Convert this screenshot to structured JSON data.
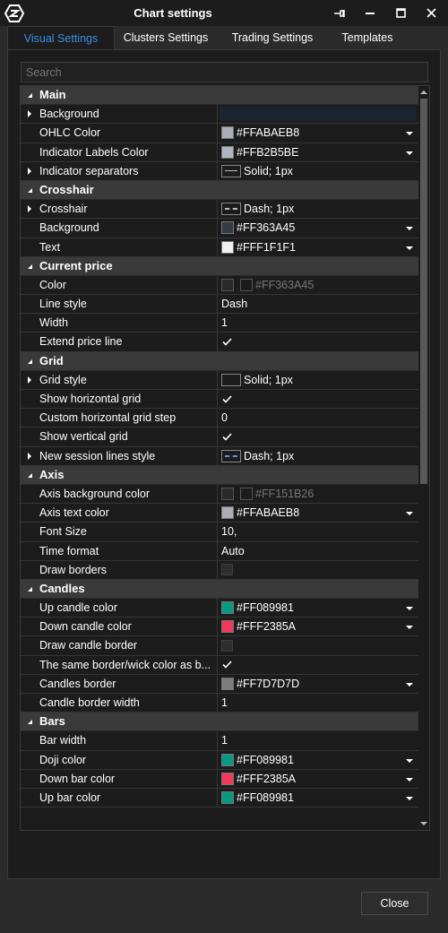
{
  "window": {
    "title": "Chart settings"
  },
  "tabs": [
    {
      "label": "Visual Settings"
    },
    {
      "label": "Clusters Settings"
    },
    {
      "label": "Trading Settings"
    },
    {
      "label": "Templates"
    }
  ],
  "search": {
    "placeholder": "Search"
  },
  "rows": [
    {
      "type": "section",
      "label": "Main"
    },
    {
      "type": "prop",
      "label": "Background",
      "expander": true,
      "value_kind": "colorbar",
      "color": "#1C2331"
    },
    {
      "type": "prop",
      "label": "OHLC Color",
      "value_kind": "color",
      "color": "#ABAEB8",
      "value": "#FFABAEB8",
      "dropdown": true
    },
    {
      "type": "prop",
      "label": "Indicator Labels Color",
      "value_kind": "color",
      "color": "#B2B5BE",
      "value": "#FFB2B5BE",
      "dropdown": true
    },
    {
      "type": "prop",
      "label": "Indicator separators",
      "expander": true,
      "value_kind": "line",
      "line": "solid",
      "value": "Solid; 1px"
    },
    {
      "type": "section",
      "label": "Crosshair"
    },
    {
      "type": "prop",
      "label": "Crosshair",
      "expander": true,
      "value_kind": "line",
      "line": "dash",
      "value": "Dash; 1px"
    },
    {
      "type": "prop",
      "label": "Background",
      "value_kind": "color",
      "color": "#363A45",
      "value": "#FF363A45",
      "dropdown": true
    },
    {
      "type": "prop",
      "label": "Text",
      "value_kind": "color",
      "color": "#F1F1F1",
      "value": "#FFF1F1F1",
      "dropdown": true
    },
    {
      "type": "section",
      "label": "Current price"
    },
    {
      "type": "prop",
      "label": "Color",
      "value_kind": "color-faded",
      "color": "#363A45",
      "value": "#FF363A45"
    },
    {
      "type": "prop",
      "label": "Line style",
      "value_kind": "text",
      "value": "Dash"
    },
    {
      "type": "prop",
      "label": "Width",
      "value_kind": "text",
      "value": "1"
    },
    {
      "type": "prop",
      "label": "Extend price line",
      "value_kind": "check",
      "checked": true
    },
    {
      "type": "section",
      "label": "Grid"
    },
    {
      "type": "prop",
      "label": "Grid style",
      "expander": true,
      "value_kind": "line",
      "line": "none",
      "value": "Solid; 1px"
    },
    {
      "type": "prop",
      "label": "Show horizontal grid",
      "value_kind": "check",
      "checked": true
    },
    {
      "type": "prop",
      "label": "Custom horizontal grid step",
      "value_kind": "text",
      "value": "0"
    },
    {
      "type": "prop",
      "label": "Show vertical grid",
      "value_kind": "check",
      "checked": true
    },
    {
      "type": "prop",
      "label": "New session lines style",
      "expander": true,
      "value_kind": "line",
      "line": "dash-blue",
      "value": "Dash; 1px"
    },
    {
      "type": "section",
      "label": "Axis"
    },
    {
      "type": "prop",
      "label": "Axis background color",
      "value_kind": "color-faded",
      "color": "#151B26",
      "value": "#FF151B26"
    },
    {
      "type": "prop",
      "label": "Axis text color",
      "value_kind": "color",
      "color": "#ABAEB8",
      "value": "#FFABAEB8",
      "dropdown": true
    },
    {
      "type": "prop",
      "label": "Font Size",
      "value_kind": "text",
      "value": "10,"
    },
    {
      "type": "prop",
      "label": "Time format",
      "value_kind": "text",
      "value": "Auto"
    },
    {
      "type": "prop",
      "label": "Draw borders",
      "value_kind": "check",
      "checked": false
    },
    {
      "type": "section",
      "label": "Candles"
    },
    {
      "type": "prop",
      "label": "Up candle color",
      "value_kind": "color",
      "color": "#089981",
      "value": "#FF089981",
      "dropdown": true
    },
    {
      "type": "prop",
      "label": "Down candle color",
      "value_kind": "color",
      "color": "#F2385A",
      "value": "#FFF2385A",
      "dropdown": true
    },
    {
      "type": "prop",
      "label": "Draw candle border",
      "value_kind": "check",
      "checked": false
    },
    {
      "type": "prop",
      "label": "The same border/wick color as b...",
      "value_kind": "check",
      "checked": true
    },
    {
      "type": "prop",
      "label": "Candles border",
      "value_kind": "color",
      "color": "#7D7D7D",
      "value": "#FF7D7D7D",
      "dropdown": true
    },
    {
      "type": "prop",
      "label": "Candle border width",
      "value_kind": "text",
      "value": "1"
    },
    {
      "type": "section",
      "label": "Bars"
    },
    {
      "type": "prop",
      "label": "Bar width",
      "value_kind": "text",
      "value": "1"
    },
    {
      "type": "prop",
      "label": "Doji color",
      "value_kind": "color",
      "color": "#089981",
      "value": "#FF089981",
      "dropdown": true
    },
    {
      "type": "prop",
      "label": "Down bar color",
      "value_kind": "color",
      "color": "#F2385A",
      "value": "#FFF2385A",
      "dropdown": true
    },
    {
      "type": "prop",
      "label": "Up bar color",
      "value_kind": "color",
      "color": "#089981",
      "value": "#FF089981",
      "dropdown": true
    }
  ],
  "footer": {
    "close_label": "Close"
  }
}
